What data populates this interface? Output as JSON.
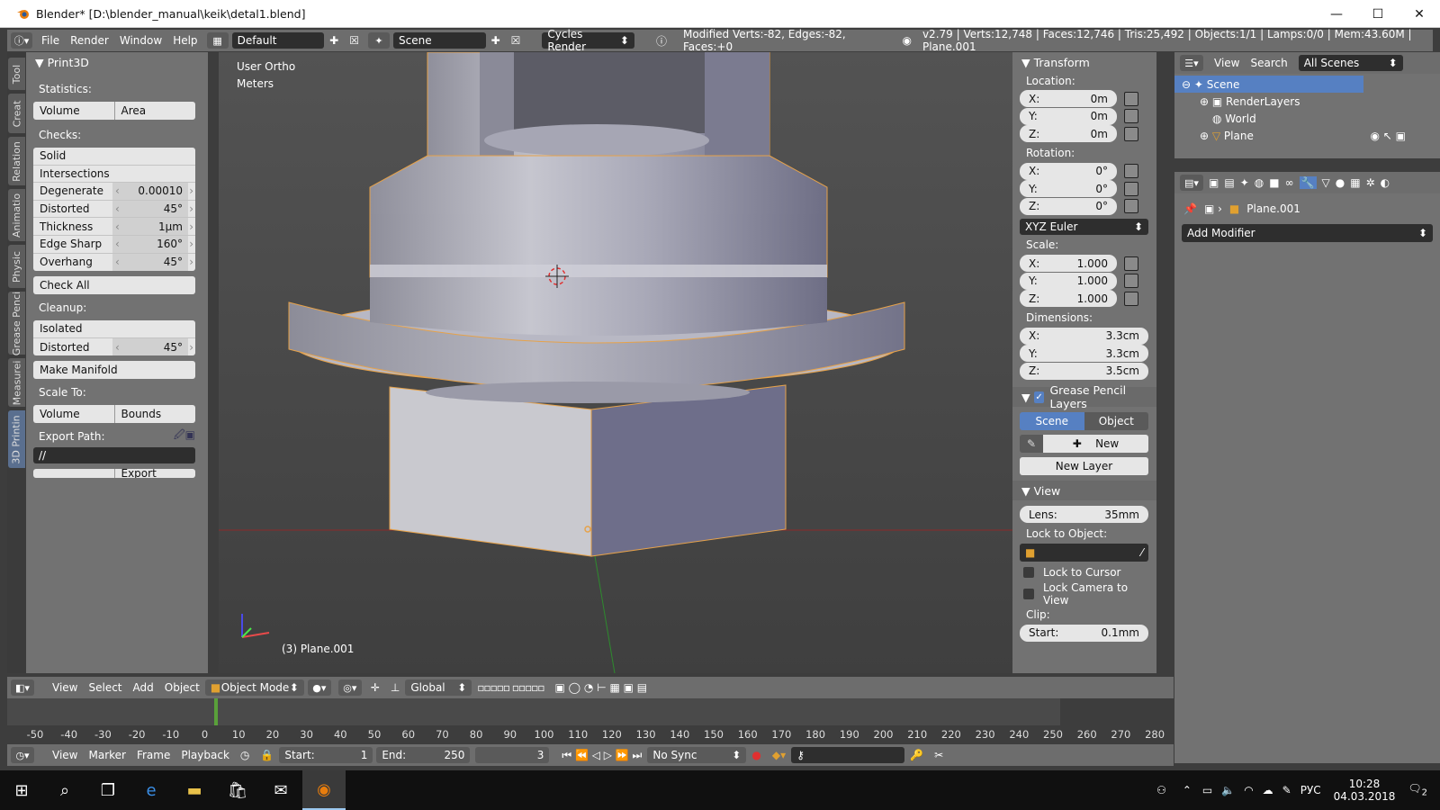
{
  "window": {
    "title": "Blender* [D:\\blender_manual\\keik\\detal1.blend]",
    "min": "—",
    "max": "☐",
    "close": "✕"
  },
  "info": {
    "menus": [
      "File",
      "Render",
      "Window",
      "Help"
    ],
    "layout": "Default",
    "scene": "Scene",
    "engine": "Cycles Render",
    "status": "Modified Verts:-82, Edges:-82, Faces:+0",
    "stats": "v2.79 | Verts:12,748 | Faces:12,746 | Tris:25,492 | Objects:1/1 | Lamps:0/0 | Mem:43.60M | Plane.001"
  },
  "tabs": [
    "Tool",
    "Creat",
    "Relation",
    "Animatio",
    "Physic",
    "Grease Penci",
    "Measurei",
    "3D Printin"
  ],
  "print3d": {
    "title": "Print3D",
    "statistics": "Statistics:",
    "volume": "Volume",
    "area": "Area",
    "checks": "Checks:",
    "solid": "Solid",
    "intersections": "Intersections",
    "degenerate": "Degenerate",
    "degenerate_val": "0.00010",
    "distorted": "Distorted",
    "distorted_val": "45°",
    "thickness": "Thickness",
    "thickness_val": "1µm",
    "edge_sharp": "Edge Sharp",
    "edge_sharp_val": "160°",
    "overhang": "Overhang",
    "overhang_val": "45°",
    "check_all": "Check All",
    "cleanup": "Cleanup:",
    "isolated": "Isolated",
    "distorted2": "Distorted",
    "distorted2_val": "45°",
    "make_manifold": "Make Manifold",
    "scale_to": "Scale To:",
    "volume2": "Volume",
    "bounds": "Bounds",
    "export_path": "Export Path:",
    "export_path_val": "//",
    "export_btn": "Export"
  },
  "viewport": {
    "view_name": "User Ortho",
    "units": "Meters",
    "object_label": "(3) Plane.001"
  },
  "transform": {
    "title": "Transform",
    "location": "Location:",
    "loc": [
      {
        "axis": "X:",
        "val": "0m"
      },
      {
        "axis": "Y:",
        "val": "0m"
      },
      {
        "axis": "Z:",
        "val": "0m"
      }
    ],
    "rotation": "Rotation:",
    "rot": [
      {
        "axis": "X:",
        "val": "0°"
      },
      {
        "axis": "Y:",
        "val": "0°"
      },
      {
        "axis": "Z:",
        "val": "0°"
      }
    ],
    "rot_mode": "XYZ Euler",
    "scale": "Scale:",
    "scl": [
      {
        "axis": "X:",
        "val": "1.000"
      },
      {
        "axis": "Y:",
        "val": "1.000"
      },
      {
        "axis": "Z:",
        "val": "1.000"
      }
    ],
    "dimensions": "Dimensions:",
    "dim": [
      {
        "axis": "X:",
        "val": "3.3cm"
      },
      {
        "axis": "Y:",
        "val": "3.3cm"
      },
      {
        "axis": "Z:",
        "val": "3.5cm"
      }
    ]
  },
  "grease": {
    "title": "Grease Pencil Layers",
    "scene_tab": "Scene",
    "object_tab": "Object",
    "new": "New",
    "new_layer": "New Layer"
  },
  "view_panel": {
    "title": "View",
    "lens_label": "Lens:",
    "lens_val": "35mm",
    "lock_to_object": "Lock to Object:",
    "lock_to_cursor": "Lock to Cursor",
    "lock_camera": "Lock Camera to View",
    "clip": "Clip:",
    "clip_start_label": "Start:",
    "clip_start_val": "0.1mm"
  },
  "outliner": {
    "view": "View",
    "search": "Search",
    "filter": "All Scenes",
    "items": [
      "Scene",
      "RenderLayers",
      "World",
      "Plane"
    ]
  },
  "properties": {
    "object": "Plane.001",
    "add_modifier": "Add Modifier"
  },
  "view3d_header": {
    "menus": [
      "View",
      "Select",
      "Add",
      "Object"
    ],
    "mode": "Object Mode",
    "orientation": "Global"
  },
  "timeline": {
    "ticks": [
      "-50",
      "-40",
      "-30",
      "-20",
      "-10",
      "0",
      "10",
      "20",
      "30",
      "40",
      "50",
      "60",
      "70",
      "80",
      "90",
      "100",
      "110",
      "120",
      "130",
      "140",
      "150",
      "160",
      "170",
      "180",
      "190",
      "200",
      "210",
      "220",
      "230",
      "240",
      "250",
      "260",
      "270",
      "280"
    ],
    "current_frame_marker": 3
  },
  "tl_header": {
    "menus": [
      "View",
      "Marker",
      "Frame",
      "Playback"
    ],
    "start_label": "Start:",
    "start_val": "1",
    "end_label": "End:",
    "end_val": "250",
    "current": "3",
    "sync": "No Sync"
  },
  "taskbar": {
    "lang": "РУС",
    "time": "10:28",
    "date": "04.03.2018",
    "notif": "2"
  }
}
